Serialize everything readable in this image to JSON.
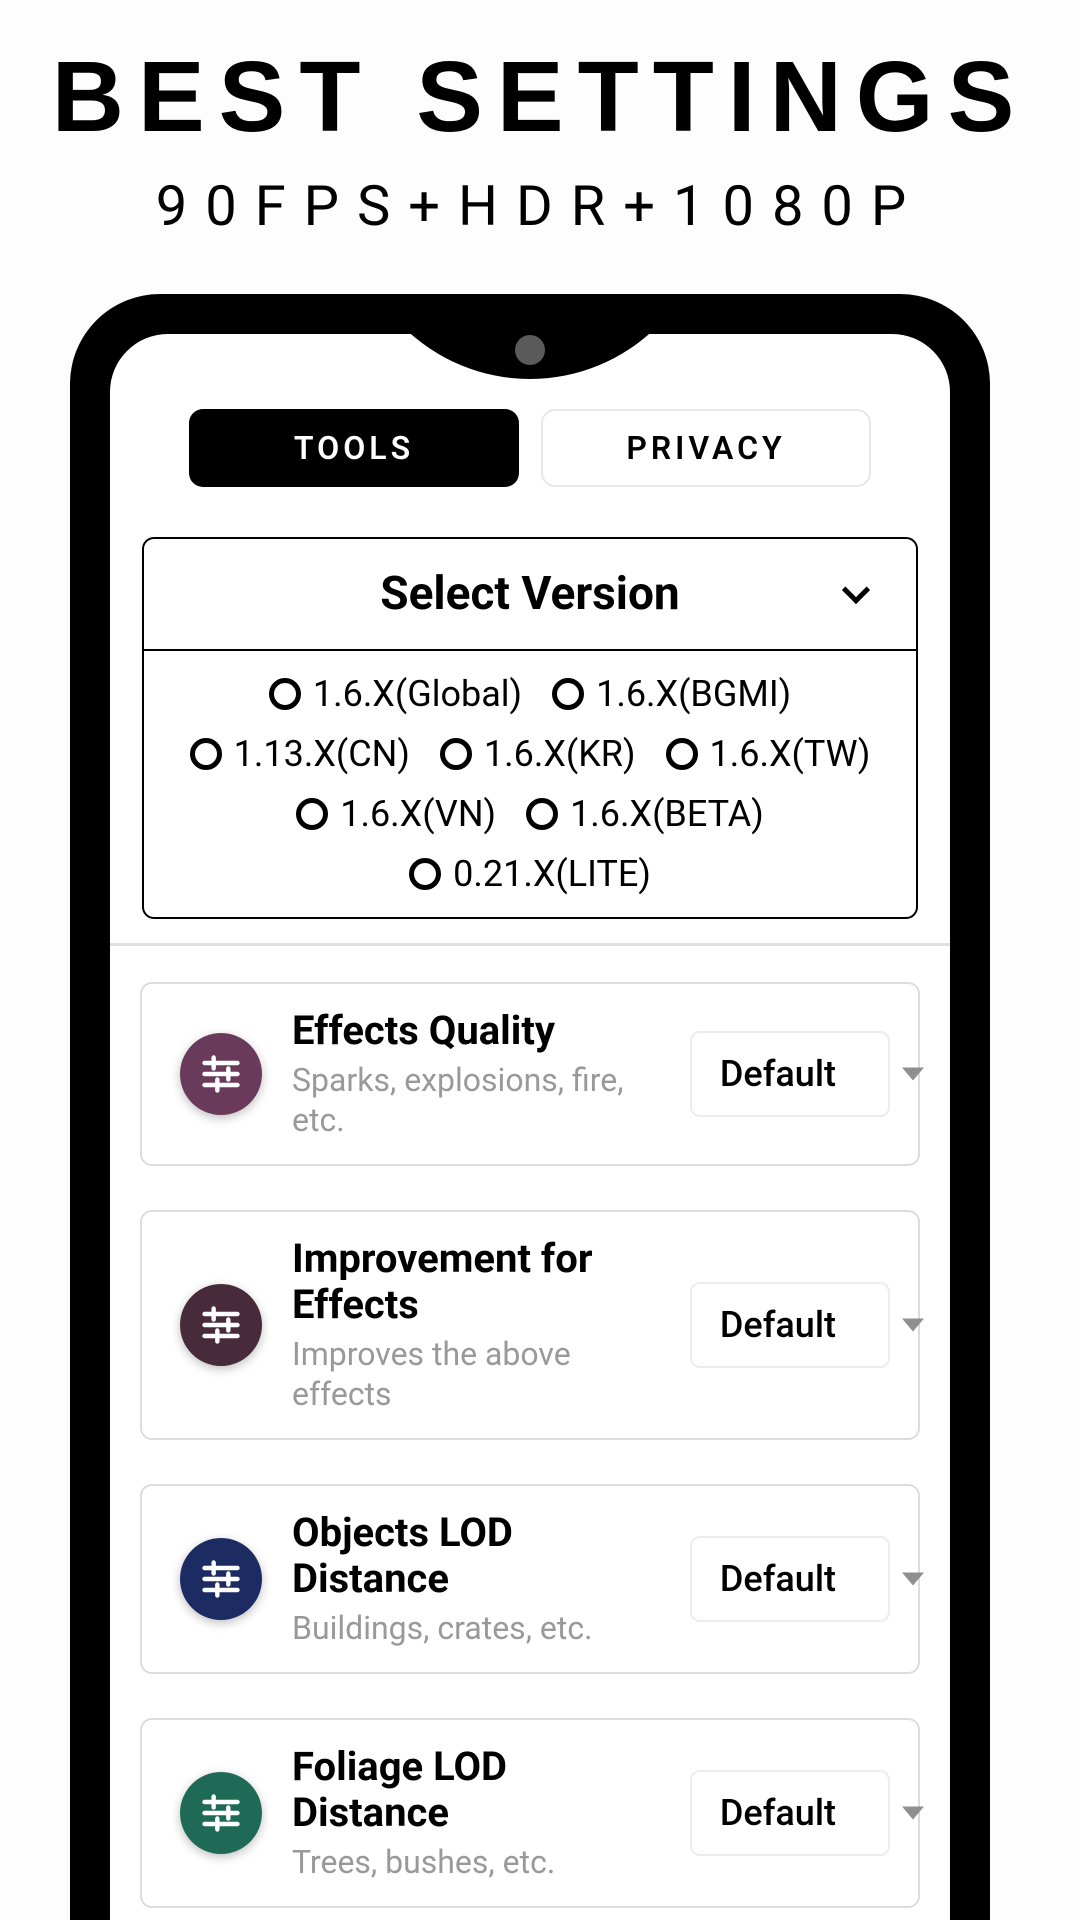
{
  "header": {
    "title": "BEST SETTINGS",
    "subtitle": "90FPS+HDR+1080P"
  },
  "tabs": {
    "tools": "TOOLS",
    "privacy": "PRIVACY"
  },
  "version": {
    "header": "Select Version",
    "options": [
      "1.6.X(Global)",
      "1.6.X(BGMI)",
      "1.13.X(CN)",
      "1.6.X(KR)",
      "1.6.X(TW)",
      "1.6.X(VN)",
      "1.6.X(BETA)",
      "0.21.X(LITE)"
    ]
  },
  "cards": [
    {
      "title": "Effects Quality",
      "desc": "Sparks, explosions, fire, etc.",
      "value": "Default",
      "color": "#6a3a5b"
    },
    {
      "title": "Improvement for Effects",
      "desc": "Improves the above effects",
      "value": "Default",
      "color": "#472b3a"
    },
    {
      "title": "Objects LOD Distance",
      "desc": "Buildings, crates, etc.",
      "value": "Default",
      "color": "#1c2c62"
    },
    {
      "title": "Foliage LOD Distance",
      "desc": "Trees, bushes, etc.",
      "value": "Default",
      "color": "#1f6a56"
    }
  ]
}
